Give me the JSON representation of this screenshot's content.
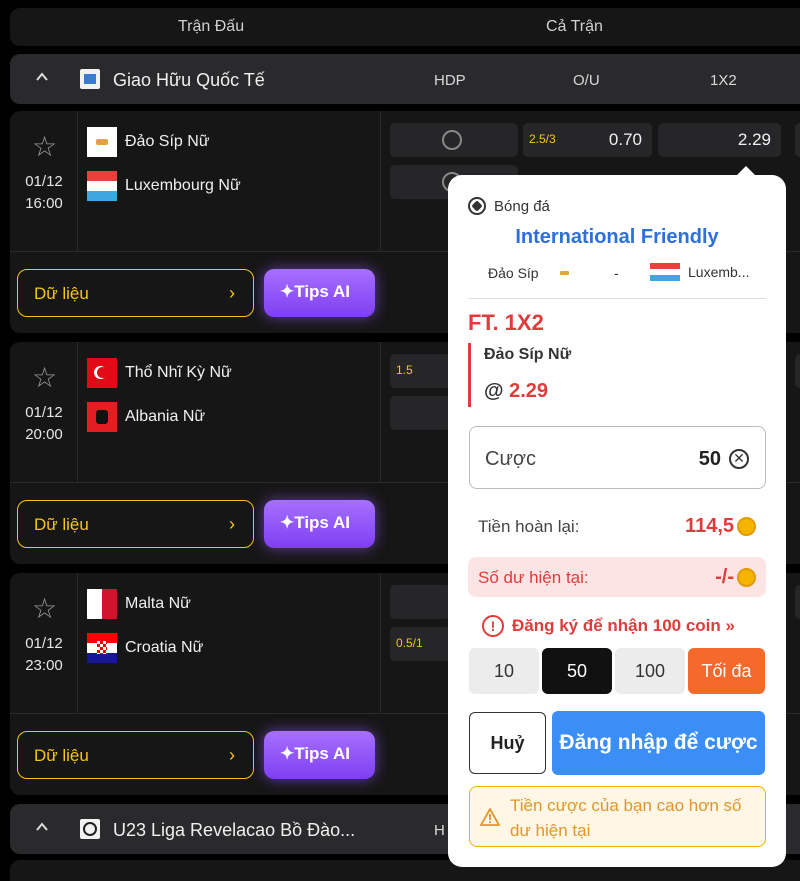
{
  "header": {
    "col_match": "Trận Đấu",
    "col_full": "Cả Trận"
  },
  "leagues": [
    {
      "name": "Giao Hữu Quốc Tế",
      "col_hdp": "HDP",
      "col_ou": "O/U",
      "col_1x2": "1X2"
    },
    {
      "name": "U23 Liga Revelacao Bồ Đào...",
      "col_hdp": "H"
    }
  ],
  "matches": [
    {
      "date": "01/12",
      "time": "16:00",
      "home": "Đảo Síp Nữ",
      "away": "Luxembourg Nữ",
      "odds": {
        "ou_line": "2.5/3",
        "ou_value": "0.70",
        "x12_home": "2.29"
      }
    },
    {
      "date": "01/12",
      "time": "20:00",
      "home": "Thổ Nhĩ Kỳ Nữ",
      "away": "Albania Nữ",
      "odds": {
        "hdp_line": "1.5"
      }
    },
    {
      "date": "01/12",
      "time": "23:00",
      "home": "Malta Nữ",
      "away": "Croatia Nữ",
      "odds": {
        "hdp_line": "0.5/1"
      }
    }
  ],
  "buttons": {
    "data": "Dữ liệu",
    "tips": "Tips AI",
    "chevron": "›"
  },
  "betslip": {
    "sport": "Bóng đá",
    "league": "International Friendly",
    "home": "Đảo Síp",
    "dash": "-",
    "away": "Luxemb...",
    "market": "FT. 1X2",
    "selection": "Đảo Síp Nữ",
    "odds_prefix": "@",
    "odds": "2.29",
    "stake_label": "Cược",
    "stake_value": "50",
    "return_label": "Tiền hoàn lại:",
    "return_value": "114,5",
    "balance_label": "Số dư hiện tại:",
    "balance_value": "-/-",
    "register_msg": "Đăng ký để nhận 100 coin »",
    "chips": [
      "10",
      "50",
      "100"
    ],
    "chip_max": "Tối đa",
    "cancel": "Huỷ",
    "login": "Đăng nhập để cược",
    "alert": "Tiền cược của bạn cao hơn số dư hiện tại"
  }
}
